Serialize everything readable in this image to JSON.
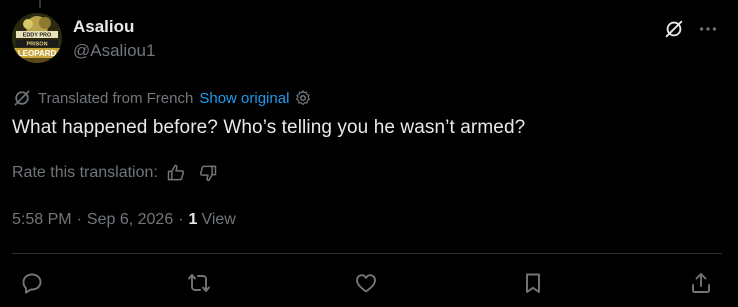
{
  "author": {
    "display_name": "Asaliou",
    "handle": "@Asaliou1",
    "avatar_text_top": "EDDY PRO",
    "avatar_text_mid": "PRISON",
    "avatar_text_bottom": "LEOPARD"
  },
  "translation": {
    "notice": "Translated from French",
    "show_original": "Show original",
    "rate_label": "Rate this translation:"
  },
  "tweet": {
    "text": "What happened before? Who’s telling you he wasn’t armed?"
  },
  "meta": {
    "time": "5:58 PM",
    "separator": "·",
    "date": "Sep 6, 2026",
    "view_count": "1",
    "view_label": "View"
  },
  "icons": {
    "translate": "no-translate-icon",
    "more": "more-icon",
    "settings": "gear-icon",
    "thumbs_up": "thumbs-up-icon",
    "thumbs_down": "thumbs-down-icon",
    "reply": "reply-icon",
    "retweet": "retweet-icon",
    "like": "heart-icon",
    "bookmark": "bookmark-icon",
    "share": "share-icon"
  },
  "colors": {
    "background": "#000000",
    "text": "#e7e9ea",
    "muted": "#71767b",
    "link": "#1d9bf0",
    "divider": "#2f3336"
  }
}
